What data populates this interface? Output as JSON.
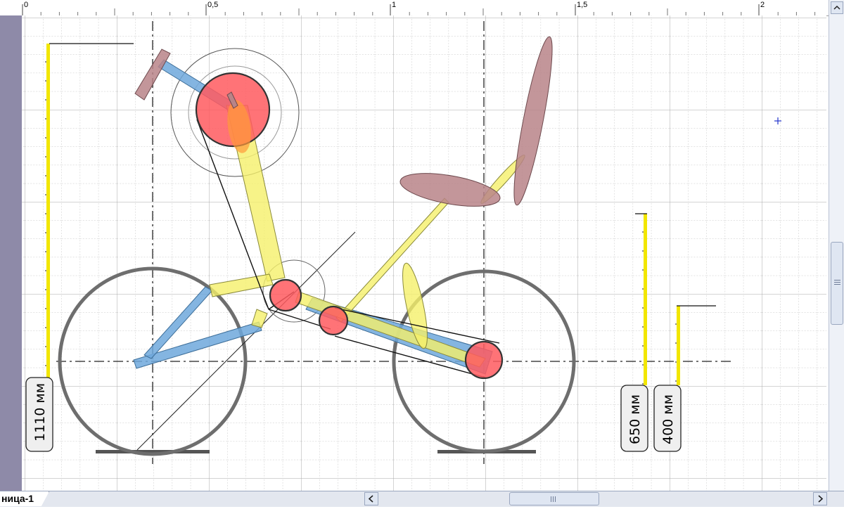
{
  "ruler": {
    "marks": [
      "0",
      "0,5",
      "1",
      "1,5",
      "2"
    ]
  },
  "dimensions": {
    "total_height": "1110 мм",
    "mid_height": "650 мм",
    "low_height": "400 мм"
  },
  "page_tab": {
    "label": "ница-1"
  },
  "scrollbar": {
    "left_arrow": "<",
    "right_arrow": ">",
    "up_arrow": "^",
    "left_icon": "chevron-left-icon",
    "right_icon": "chevron-right-icon",
    "up_icon": "chevron-up-icon"
  },
  "colors": {
    "grid": "#c6c6c6",
    "frame_blue": "#6fa8dc",
    "boom_yellow": "#f5f06a",
    "joint_red": "#ff5a5f",
    "seat_brown": "#b88488",
    "wheel_gray": "#6e6e6e",
    "dim_yellow": "#f2e600"
  }
}
